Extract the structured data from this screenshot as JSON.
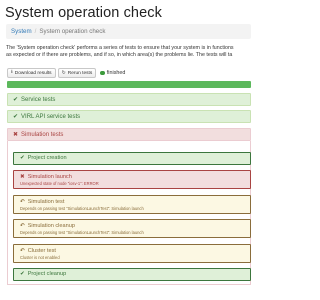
{
  "page_title": "System operation check",
  "breadcrumb": {
    "home": "System",
    "separator": "/",
    "current": "System operation check"
  },
  "description": [
    "The 'System operation check' performs a series of tests to ensure that your system is in functions",
    "as expected or if there are problems, and if so, in which area(s) the problems lie. The tests will ta"
  ],
  "toolbar": {
    "download_label": "Download results",
    "rerun_label": "Rerun tests",
    "status_label": "finished"
  },
  "progress": {
    "fraction": 1.0
  },
  "colors": {
    "success": "#5cb85c",
    "danger": "#a94442",
    "warning": "#8a6d3b"
  },
  "groups": [
    {
      "label": "Service tests",
      "status": "success",
      "icon": "check-icon",
      "glyph": "✔"
    },
    {
      "label": "VIRL API service tests",
      "status": "success",
      "icon": "check-icon",
      "glyph": "✔"
    },
    {
      "label": "Simulation tests",
      "status": "danger",
      "icon": "cross-icon",
      "glyph": "✖"
    }
  ],
  "subtests": [
    {
      "title": "Project creation",
      "status": "success",
      "icon": "check-icon",
      "glyph": "✔"
    },
    {
      "title": "Simulation launch",
      "detail": "Unexpected state of node \"iosv-1\": ERROR",
      "status": "danger",
      "icon": "cross-icon",
      "glyph": "✖"
    },
    {
      "title": "Simulation test",
      "detail": "Depends on passing test \"SimulationLaunchTest\": Simulation launch",
      "status": "warning",
      "icon": "undo-arrow-icon",
      "glyph": "↶"
    },
    {
      "title": "Simulation cleanup",
      "detail": "Depends on passing test \"SimulationLaunchTest\": Simulation launch",
      "status": "warning",
      "icon": "undo-arrow-icon",
      "glyph": "↶"
    },
    {
      "title": "Cluster test",
      "detail": "Cluster is not enabled",
      "status": "warning",
      "icon": "undo-arrow-icon",
      "glyph": "↶"
    },
    {
      "title": "Project cleanup",
      "status": "success",
      "icon": "check-icon",
      "glyph": "✔"
    }
  ]
}
